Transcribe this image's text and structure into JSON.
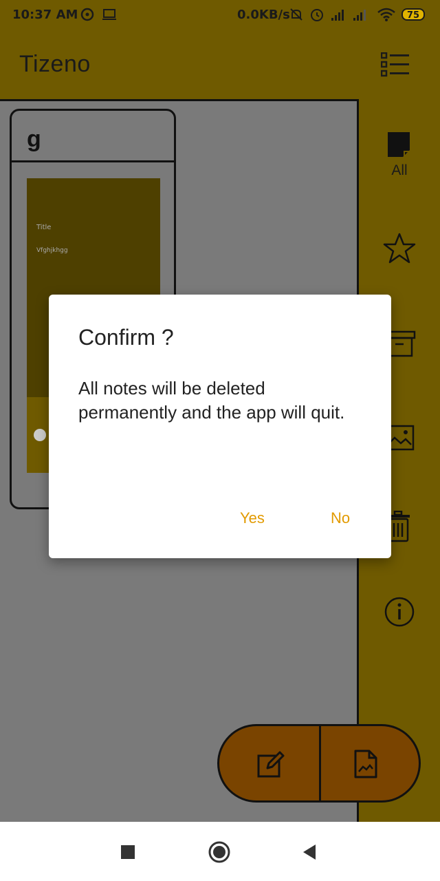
{
  "status_bar": {
    "time": "10:37 AM",
    "net_speed": "0.0KB/s",
    "battery": "75",
    "icons": [
      "chat-icon",
      "laptop-icon",
      "mute-icon",
      "alarm-icon",
      "signal-icon",
      "wifi-icon",
      "battery-icon"
    ]
  },
  "app_bar": {
    "title": "Tizeno",
    "menu_icon": "list-view-icon"
  },
  "note": {
    "title": "g",
    "thumbnail_title": "Title",
    "thumbnail_body": "Vfghjkhgg"
  },
  "side_rail": {
    "all_label": "All",
    "items": [
      "all-notes-icon",
      "star-icon",
      "archive-icon",
      "image-icon",
      "trash-icon",
      "info-icon"
    ]
  },
  "fab": {
    "icons": [
      "edit-note-icon",
      "image-note-icon"
    ]
  },
  "dialog": {
    "title": "Confirm ?",
    "message": "All notes will be deleted permanently and the app will quit.",
    "yes_label": "Yes",
    "no_label": "No"
  },
  "colors": {
    "app_bar": "#6f5a00",
    "scrim": "#7a7a7a",
    "accent": "#e29a00",
    "fab": "#7a4400"
  }
}
